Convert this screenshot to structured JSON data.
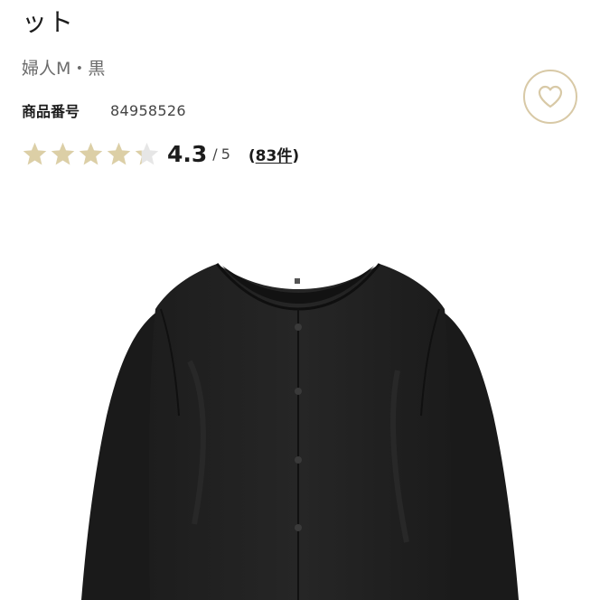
{
  "product": {
    "title_tail": "ット",
    "subtitle": "婦人M・黒",
    "product_number_label": "商品番号",
    "product_number": "84958526"
  },
  "rating": {
    "value": "4.3",
    "separator": "/",
    "max": "5",
    "score": 4.3,
    "review_open": "(",
    "review_count": "83件",
    "review_close": ")",
    "star_filled_color": "#dccfa6",
    "star_empty_color": "#e6e6e6"
  },
  "favorite": {
    "icon": "heart-icon",
    "border_color": "#d8c9a6",
    "icon_color": "#d8c9a6"
  },
  "image": {
    "subject": "black-collarless-quilted-jacket-icon"
  }
}
